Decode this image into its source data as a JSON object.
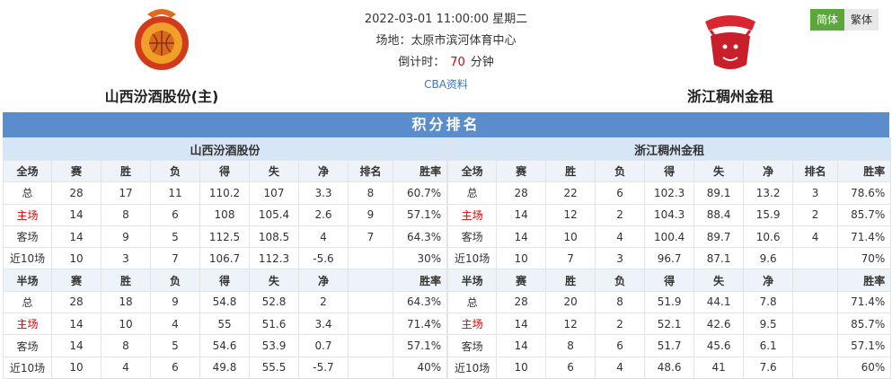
{
  "match": {
    "datetime": "2022-03-01 11:00:00 星期二",
    "venue": "场地：太原市滨河体育中心",
    "countdown_label": "倒计时：",
    "countdown_value": "70",
    "countdown_unit": "分钟",
    "cba_link": "CBA资料"
  },
  "home_team": {
    "name": "山西汾酒股份(主)",
    "logo_text": "SHANXI LOONGS"
  },
  "away_team": {
    "name": "浙江稠州金租",
    "logo_text": "GOLDENBULLS"
  },
  "lang": {
    "simplified": "简体",
    "traditional": "繁体"
  },
  "section_title": "积分排名",
  "standings": {
    "home": {
      "team": "山西汾酒股份",
      "full_header": [
        "全场",
        "赛",
        "胜",
        "负",
        "得",
        "失",
        "净",
        "排名",
        "胜率"
      ],
      "full_rows": [
        [
          "总",
          "28",
          "17",
          "11",
          "110.2",
          "107",
          "3.3",
          "8",
          "60.7%"
        ],
        [
          "主场",
          "14",
          "8",
          "6",
          "108",
          "105.4",
          "2.6",
          "9",
          "57.1%"
        ],
        [
          "客场",
          "14",
          "9",
          "5",
          "112.5",
          "108.5",
          "4",
          "7",
          "64.3%"
        ],
        [
          "近10场",
          "10",
          "3",
          "7",
          "106.7",
          "112.3",
          "-5.6",
          "",
          "30%"
        ]
      ],
      "half_header": [
        "半场",
        "赛",
        "胜",
        "负",
        "得",
        "失",
        "净",
        "",
        "胜率"
      ],
      "half_rows": [
        [
          "总",
          "28",
          "18",
          "9",
          "54.8",
          "52.8",
          "2",
          "",
          "64.3%"
        ],
        [
          "主场",
          "14",
          "10",
          "4",
          "55",
          "51.6",
          "3.4",
          "",
          "71.4%"
        ],
        [
          "客场",
          "14",
          "8",
          "5",
          "54.6",
          "53.9",
          "0.7",
          "",
          "57.1%"
        ],
        [
          "近10场",
          "10",
          "4",
          "6",
          "49.8",
          "55.5",
          "-5.7",
          "",
          "40%"
        ]
      ]
    },
    "away": {
      "team": "浙江稠州金租",
      "full_header": [
        "全场",
        "赛",
        "胜",
        "负",
        "得",
        "失",
        "净",
        "排名",
        "胜率"
      ],
      "full_rows": [
        [
          "总",
          "28",
          "22",
          "6",
          "102.3",
          "89.1",
          "13.2",
          "3",
          "78.6%"
        ],
        [
          "主场",
          "14",
          "12",
          "2",
          "104.3",
          "88.4",
          "15.9",
          "2",
          "85.7%"
        ],
        [
          "客场",
          "14",
          "10",
          "4",
          "100.4",
          "89.7",
          "10.6",
          "4",
          "71.4%"
        ],
        [
          "近10场",
          "10",
          "7",
          "3",
          "96.7",
          "87.1",
          "9.6",
          "",
          "70%"
        ]
      ],
      "half_header": [
        "半场",
        "赛",
        "胜",
        "负",
        "得",
        "失",
        "净",
        "",
        "胜率"
      ],
      "half_rows": [
        [
          "总",
          "28",
          "20",
          "8",
          "51.9",
          "44.1",
          "7.8",
          "",
          "71.4%"
        ],
        [
          "主场",
          "14",
          "12",
          "2",
          "52.1",
          "42.6",
          "9.5",
          "",
          "85.7%"
        ],
        [
          "客场",
          "14",
          "8",
          "6",
          "51.7",
          "45.6",
          "6.1",
          "",
          "57.1%"
        ],
        [
          "近10场",
          "10",
          "6",
          "4",
          "48.6",
          "41",
          "7.6",
          "",
          "60%"
        ]
      ]
    }
  },
  "colors": {
    "accent_red": "#e00000",
    "section_blue": "#5b8ccb",
    "lang_green": "#5aa83a"
  }
}
